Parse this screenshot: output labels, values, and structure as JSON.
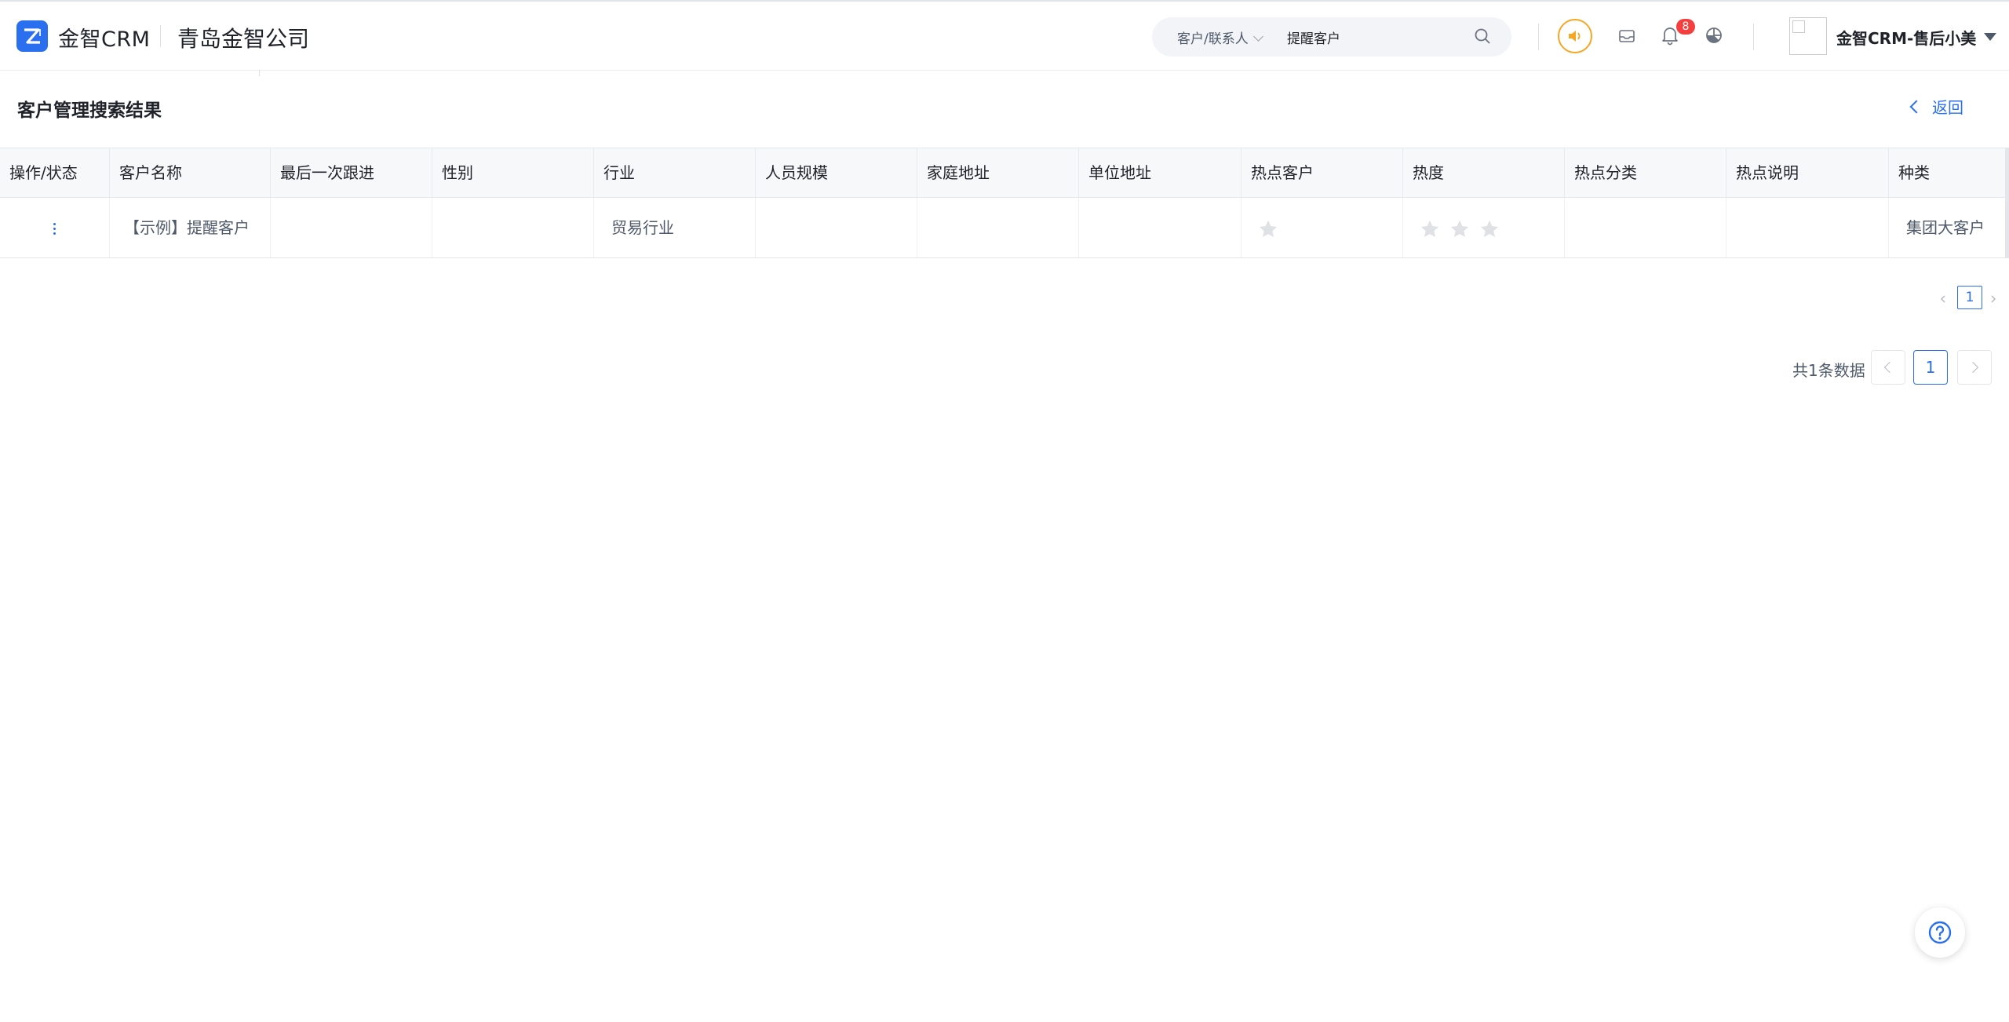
{
  "header": {
    "brand": "金智CRM",
    "company": "青岛金智公司",
    "search": {
      "type_label": "客户/联系人",
      "value": "提醒客户"
    },
    "notification_count": "8",
    "username": "金智CRM-售后小美"
  },
  "page": {
    "title": "客户管理搜索结果",
    "back_label": "返回"
  },
  "table": {
    "columns": [
      "操作/状态",
      "客户名称",
      "最后一次跟进",
      "性别",
      "行业",
      "人员规模",
      "家庭地址",
      "单位地址",
      "热点客户",
      "热度",
      "热点分类",
      "热点说明",
      "种类"
    ],
    "rows": [
      {
        "name": "【示例】提醒客户",
        "last_followup": "",
        "gender": "",
        "industry": "贸易行业",
        "staff_size": "",
        "home_address": "",
        "work_address": "",
        "hot_customer_stars": 1,
        "heat_stars": 3,
        "hot_category": "",
        "hot_note": "",
        "kind": "集团大客户"
      }
    ]
  },
  "pagination": {
    "top_page": "1",
    "total_text": "共1条数据",
    "current_page": "1"
  },
  "colors": {
    "accent": "#2a6ff0",
    "badge": "#f53f3f",
    "speaker": "#f5a623",
    "star_inactive": "#dfe1e5"
  },
  "icons": [
    "logo-icon",
    "search-icon",
    "speaker-icon",
    "message-icon",
    "bell-icon",
    "pie-chart-icon",
    "help-icon"
  ]
}
